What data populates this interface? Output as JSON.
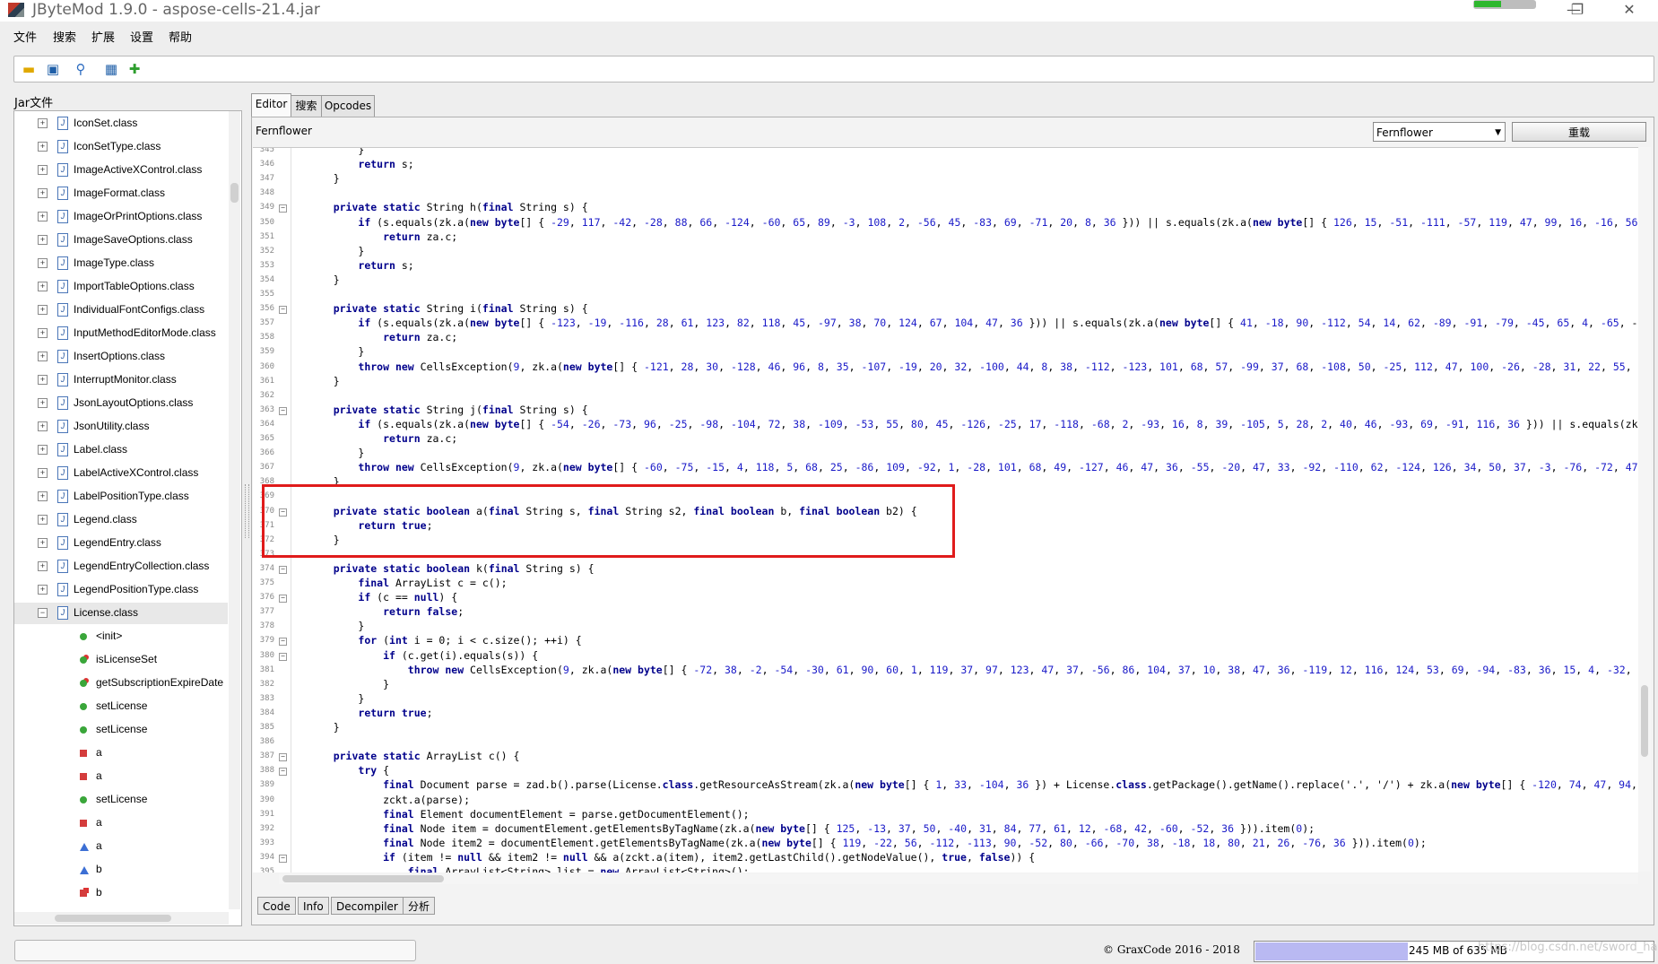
{
  "window": {
    "title": "JByteMod 1.9.0 - aspose-cells-21.4.jar",
    "minimize": "—",
    "restore": "❐",
    "close": "✕"
  },
  "menu": [
    "文件",
    "搜索",
    "扩展",
    "设置",
    "帮助"
  ],
  "toolbar": {
    "icons": [
      "open-folder-icon",
      "save-icon",
      "search-icon",
      "calculator-icon",
      "plugin-icon"
    ]
  },
  "sidebar": {
    "title": "Jar文件",
    "classes": [
      "IconSet.class",
      "IconSetType.class",
      "ImageActiveXControl.class",
      "ImageFormat.class",
      "ImageOrPrintOptions.class",
      "ImageSaveOptions.class",
      "ImageType.class",
      "ImportTableOptions.class",
      "IndividualFontConfigs.class",
      "InputMethodEditorMode.class",
      "InsertOptions.class",
      "InterruptMonitor.class",
      "JsonLayoutOptions.class",
      "JsonUtility.class",
      "Label.class",
      "LabelActiveXControl.class",
      "LabelPositionType.class",
      "Legend.class",
      "LegendEntry.class",
      "LegendEntryCollection.class",
      "LegendPositionType.class"
    ],
    "selected": "License.class",
    "members": [
      {
        "label": "<init>",
        "kind": "public"
      },
      {
        "label": "isLicenseSet",
        "kind": "static-public"
      },
      {
        "label": "getSubscriptionExpireDate",
        "kind": "static-public"
      },
      {
        "label": "setLicense",
        "kind": "public"
      },
      {
        "label": "setLicense",
        "kind": "public"
      },
      {
        "label": "a",
        "kind": "private"
      },
      {
        "label": "a",
        "kind": "private"
      },
      {
        "label": "setLicense",
        "kind": "public"
      },
      {
        "label": "a",
        "kind": "private"
      },
      {
        "label": "a",
        "kind": "protected"
      },
      {
        "label": "b",
        "kind": "protected"
      },
      {
        "label": "b",
        "kind": "static-private"
      }
    ]
  },
  "tabs": [
    "Editor",
    "搜索",
    "Opcodes"
  ],
  "editor": {
    "decompiler_label": "Fernflower",
    "decompiler_select": "Fernflower",
    "reload_label": "重载",
    "lines": [
      {
        "n": "345",
        "t": "        }"
      },
      {
        "n": "346",
        "t": "        return s;"
      },
      {
        "n": "347",
        "t": "    }"
      },
      {
        "n": "348",
        "t": ""
      },
      {
        "n": "349",
        "t": "    private static String h(final String s) {"
      },
      {
        "n": "350",
        "t": "        if (s.equals(zk.a(new byte[] { -29, 117, -42, -28, 88, 66, -124, -60, 65, 89, -3, 108, 2, -56, 45, -83, 69, -71, 20, 8, 36 })) || s.equals(zk.a(new byte[] { 126, 15, -51, -111, -57, 119, 47, 99, 16, -16, 56,"
      },
      {
        "n": "351",
        "t": "            return za.c;"
      },
      {
        "n": "352",
        "t": "        }"
      },
      {
        "n": "353",
        "t": "        return s;"
      },
      {
        "n": "354",
        "t": "    }"
      },
      {
        "n": "355",
        "t": ""
      },
      {
        "n": "356",
        "t": "    private static String i(final String s) {"
      },
      {
        "n": "357",
        "t": "        if (s.equals(zk.a(new byte[] { -123, -19, -116, 28, 61, 123, 82, 118, 45, -97, 38, 70, 124, 67, 104, 47, 36 })) || s.equals(zk.a(new byte[] { 41, -18, 90, -112, 54, 14, 62, -89, -91, -79, -45, 65, 4, -65, -1"
      },
      {
        "n": "358",
        "t": "            return za.c;"
      },
      {
        "n": "359",
        "t": "        }"
      },
      {
        "n": "360",
        "t": "        throw new CellsException(9, zk.a(new byte[] { -121, 28, 30, -128, 46, 96, 8, 35, -107, -19, 20, 32, -100, 44, 8, 38, -112, -123, 101, 68, 57, -99, 37, 68, -108, 50, -25, 112, 47, 100, -26, -28, 31, 22, 55, -"
      },
      {
        "n": "361",
        "t": "    }"
      },
      {
        "n": "362",
        "t": ""
      },
      {
        "n": "363",
        "t": "    private static String j(final String s) {"
      },
      {
        "n": "364",
        "t": "        if (s.equals(zk.a(new byte[] { -54, -26, -73, 96, -25, -98, -104, 72, 38, -109, -53, 55, 80, 45, -126, -25, 17, -118, -68, 2, -93, 16, 8, 39, -105, 5, 28, 2, 40, 46, -93, 69, -91, 116, 36 })) || s.equals(zk."
      },
      {
        "n": "365",
        "t": "            return za.c;"
      },
      {
        "n": "366",
        "t": "        }"
      },
      {
        "n": "367",
        "t": "        throw new CellsException(9, zk.a(new byte[] { -60, -75, -15, 4, 118, 5, 68, 25, -86, 109, -92, 1, -28, 101, 68, 49, -127, 46, 47, 36, -55, -20, 47, 33, -92, -110, 62, -124, 126, 34, 50, 37, -3, -76, -72, 47,"
      },
      {
        "n": "368",
        "t": "    }"
      },
      {
        "n": "369",
        "t": ""
      },
      {
        "n": "370",
        "t": "    private static boolean a(final String s, final String s2, final boolean b, final boolean b2) {"
      },
      {
        "n": "371",
        "t": "        return true;"
      },
      {
        "n": "372",
        "t": "    }"
      },
      {
        "n": "373",
        "t": ""
      },
      {
        "n": "374",
        "t": "    private static boolean k(final String s) {"
      },
      {
        "n": "375",
        "t": "        final ArrayList c = c();"
      },
      {
        "n": "376",
        "t": "        if (c == null) {"
      },
      {
        "n": "377",
        "t": "            return false;"
      },
      {
        "n": "378",
        "t": "        }"
      },
      {
        "n": "379",
        "t": "        for (int i = 0; i < c.size(); ++i) {"
      },
      {
        "n": "380",
        "t": "            if (c.get(i).equals(s)) {"
      },
      {
        "n": "381",
        "t": "                throw new CellsException(9, zk.a(new byte[] { -72, 38, -2, -54, -30, 61, 90, 60, 1, 119, 37, 97, 123, 47, 37, -56, 86, 104, 37, 10, 38, 47, 36, -119, 12, 116, 124, 53, 69, -94, -83, 36, 15, 4, -32, -"
      },
      {
        "n": "382",
        "t": "            }"
      },
      {
        "n": "383",
        "t": "        }"
      },
      {
        "n": "384",
        "t": "        return true;"
      },
      {
        "n": "385",
        "t": "    }"
      },
      {
        "n": "386",
        "t": ""
      },
      {
        "n": "387",
        "t": "    private static ArrayList c() {"
      },
      {
        "n": "388",
        "t": "        try {"
      },
      {
        "n": "389",
        "t": "            final Document parse = zad.b().parse(License.class.getResourceAsStream(zk.a(new byte[] { 1, 33, -104, 36 }) + License.class.getPackage().getName().replace('.', '/') + zk.a(new byte[] { -120, 74, 47, 94, 1"
      },
      {
        "n": "390",
        "t": "            zckt.a(parse);"
      },
      {
        "n": "391",
        "t": "            final Element documentElement = parse.getDocumentElement();"
      },
      {
        "n": "392",
        "t": "            final Node item = documentElement.getElementsByTagName(zk.a(new byte[] { 125, -13, 37, 50, -40, 31, 84, 77, 61, 12, -68, 42, -60, -52, 36 })).item(0);"
      },
      {
        "n": "393",
        "t": "            final Node item2 = documentElement.getElementsByTagName(zk.a(new byte[] { 119, -22, 56, -112, -113, 90, -52, 80, -66, -70, 38, -18, 18, 80, 21, 26, -76, 36 })).item(0);"
      },
      {
        "n": "394",
        "t": "            if (item != null && item2 != null && a(zckt.a(item), item2.getLastChild().getNodeValue(), true, false)) {"
      },
      {
        "n": "395",
        "t": "                final ArrayList<String> list = new ArrayList<String>();"
      }
    ]
  },
  "bottom_tabs": [
    "Code",
    "Info",
    "Decompiler",
    "分析"
  ],
  "status": {
    "copyright": "© GraxCode  2016 - 2018",
    "memory_text": "245 MB of 635 MB",
    "memory_used_mb": 245,
    "memory_total_mb": 635,
    "watermark": "https://blog.csdn.net/sword_happy"
  },
  "colors": {
    "highlight_box": "#e01b1b",
    "keyword": "#00008b",
    "number": "#1a1ac8"
  }
}
